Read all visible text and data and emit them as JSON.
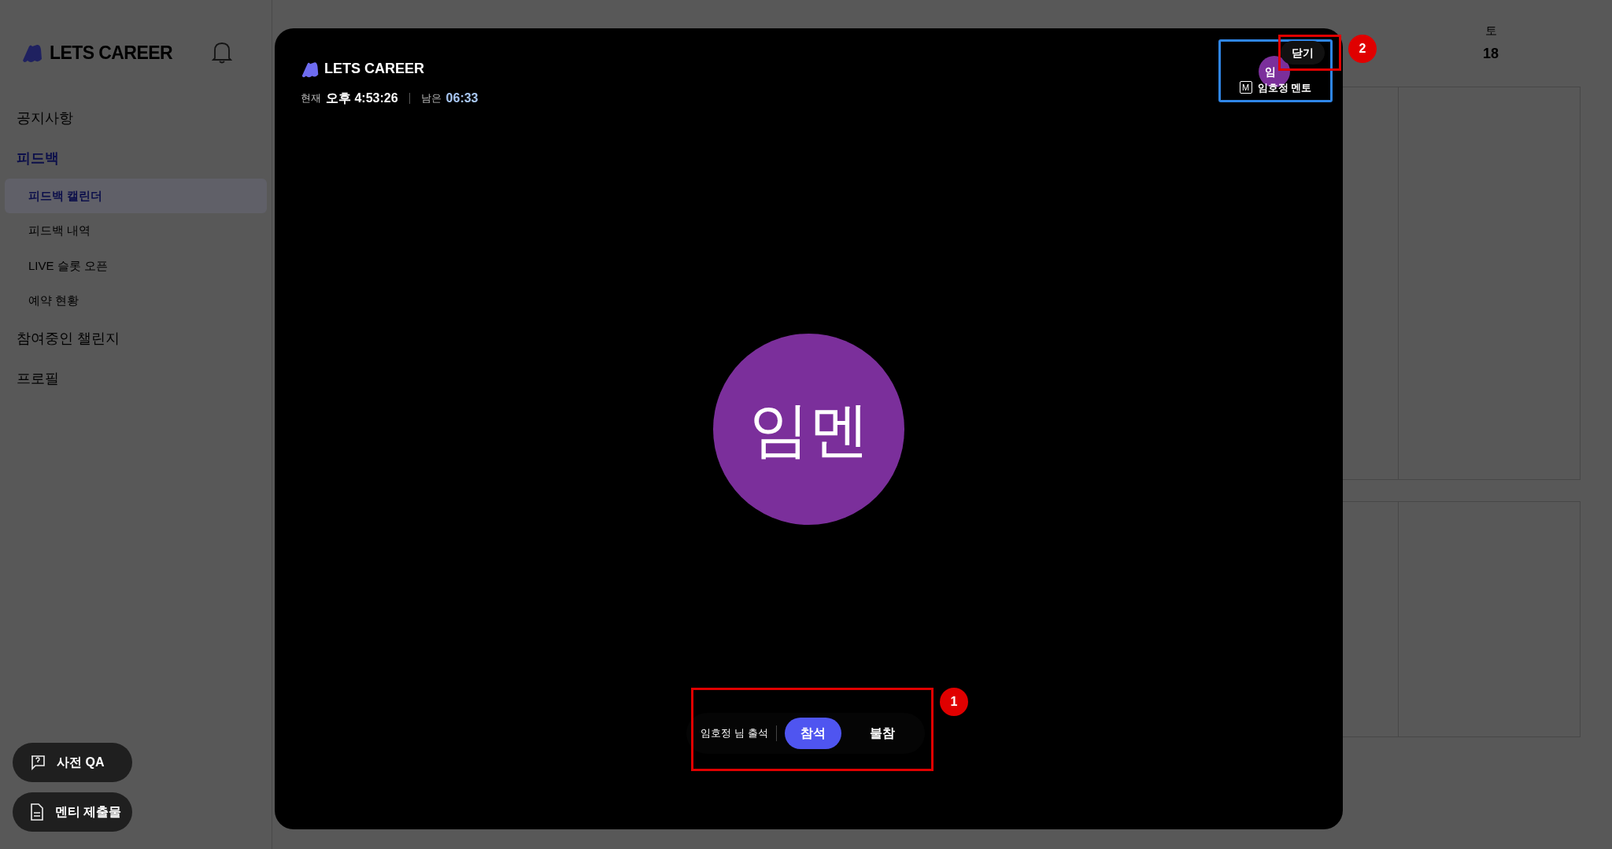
{
  "sidebar": {
    "logo": "LETS CAREER",
    "items": [
      {
        "label": "공지사항",
        "selected": false
      },
      {
        "label": "피드백",
        "selected": true,
        "children": [
          {
            "label": "피드백 캘린더",
            "selected": true
          },
          {
            "label": "피드백 내역",
            "selected": false
          },
          {
            "label": "LIVE 슬롯 오픈",
            "selected": false
          },
          {
            "label": "예약 현황",
            "selected": false
          }
        ]
      },
      {
        "label": "참여중인 챌린지",
        "selected": false
      },
      {
        "label": "프로필",
        "selected": false
      }
    ]
  },
  "floating_buttons": [
    {
      "label": "사전 QA",
      "kind": "question"
    },
    {
      "label": "멘티 제출물",
      "kind": "document"
    }
  ],
  "calendar": {
    "weekday": "토",
    "date": "18"
  },
  "call_modal": {
    "logo": "LETS CAREER",
    "now_label": "현재",
    "now": "오후 4:53:26",
    "remaining_label": "남은",
    "remaining": "06:33",
    "self_view": {
      "avatar": "임",
      "role_badge": "M",
      "name": "임호정 멘토"
    },
    "close": "닫기",
    "participant_avatar": "임멘",
    "attendance": {
      "label": "임호정 님 출석",
      "options": [
        {
          "label": "참석",
          "selected": true
        },
        {
          "label": "불참",
          "selected": false
        }
      ]
    }
  },
  "annotations": [
    {
      "number": "1"
    },
    {
      "number": "2"
    }
  ]
}
